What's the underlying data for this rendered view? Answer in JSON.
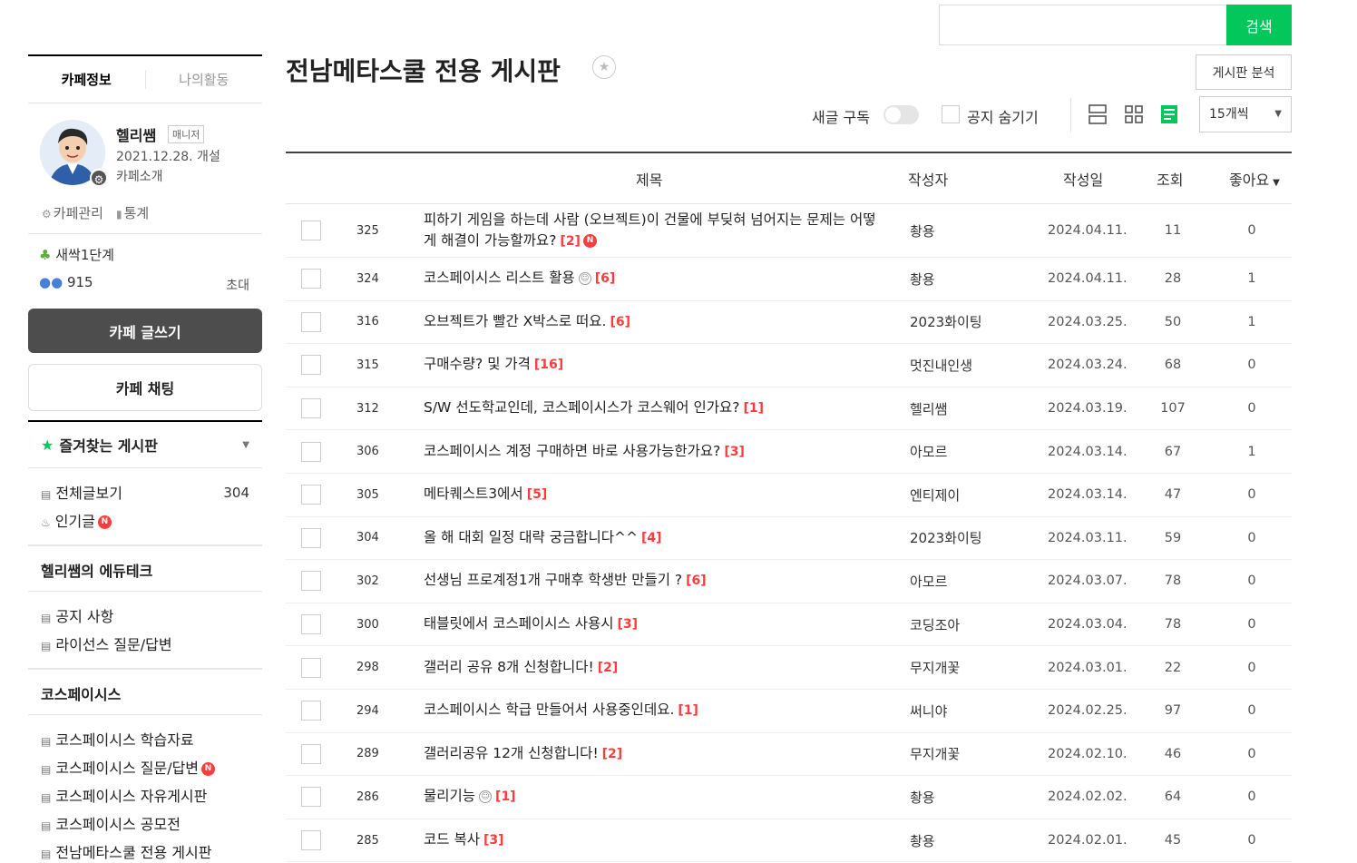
{
  "search": {
    "placeholder": "",
    "button_label": "검색"
  },
  "sidebar": {
    "tabs": [
      "카페정보",
      "나의활동"
    ],
    "manager": {
      "name": "헬리쌤",
      "badge": "매니저",
      "date": "2021.12.28. 개설",
      "intro": "카페소개"
    },
    "admin_links": [
      "카페관리",
      "통계"
    ],
    "level": "새싹1단계",
    "members": "915",
    "invite": "초대",
    "write_button": "카페 글쓰기",
    "chat_button": "카페 채팅",
    "favorites": "즐겨찾는 게시판",
    "group1": [
      {
        "label": "전체글보기",
        "count": "304"
      },
      {
        "label": "인기글"
      }
    ],
    "group2_title": "헬리쌤의 에듀테크",
    "group2": [
      "공지 사항",
      "라이선스 질문/답변"
    ],
    "group3_title": "코스페이시스",
    "group3": [
      "코스페이시스 학습자료",
      "코스페이시스 질문/답변",
      "코스페이시스 자유게시판",
      "코스페이시스 공모전",
      "전남메타스쿨 전용 게시판"
    ]
  },
  "board": {
    "title": "전남메타스쿨 전용 게시판",
    "analysis_button": "게시판 분석",
    "subscribe_label": "새글 구독",
    "hide_notice_label": "공지 숨기기",
    "per_page": "15개씩"
  },
  "table": {
    "headers": {
      "title": "제목",
      "author": "작성자",
      "date": "작성일",
      "views": "조회",
      "likes": "좋아요"
    },
    "rows": [
      {
        "num": "325",
        "title": "피하기 게임을 하는데 사람 (오브젝트)이 건물에 부딪혀 넘어지는 문제는 어떻게 해결이 가능할까요?",
        "comments": "[2]",
        "author": "촹용",
        "date": "2024.04.11.",
        "views": "11",
        "likes": "0"
      },
      {
        "num": "324",
        "title": "코스페이시스 리스트 활용",
        "comments": "[6]",
        "author": "촹용",
        "date": "2024.04.11.",
        "views": "28",
        "likes": "1"
      },
      {
        "num": "316",
        "title": "오브젝트가 빨간 X박스로 떠요.",
        "comments": "[6]",
        "author": "2023화이팅",
        "date": "2024.03.25.",
        "views": "50",
        "likes": "1"
      },
      {
        "num": "315",
        "title": "구매수량? 및 가격",
        "comments": "[16]",
        "author": "멋진내인생",
        "date": "2024.03.24.",
        "views": "68",
        "likes": "0"
      },
      {
        "num": "312",
        "title": "S/W 선도학교인데, 코스페이시스가 코스웨어 인가요?",
        "comments": "[1]",
        "author": "헬리쌤",
        "date": "2024.03.19.",
        "views": "107",
        "likes": "0"
      },
      {
        "num": "306",
        "title": "코스페이시스 계정 구매하면 바로 사용가능한가요?",
        "comments": "[3]",
        "author": "아모르",
        "date": "2024.03.14.",
        "views": "67",
        "likes": "1"
      },
      {
        "num": "305",
        "title": "메타퀘스트3에서",
        "comments": "[5]",
        "author": "엔티제이",
        "date": "2024.03.14.",
        "views": "47",
        "likes": "0"
      },
      {
        "num": "304",
        "title": "올 해 대회 일정 대략 궁금합니다^^",
        "comments": "[4]",
        "author": "2023화이팅",
        "date": "2024.03.11.",
        "views": "59",
        "likes": "0"
      },
      {
        "num": "302",
        "title": "선생님 프로계정1개 구매후 학생반 만들기 ?",
        "comments": "[6]",
        "author": "아모르",
        "date": "2024.03.07.",
        "views": "78",
        "likes": "0"
      },
      {
        "num": "300",
        "title": "태블릿에서 코스페이시스 사용시",
        "comments": "[3]",
        "author": "코딩조아",
        "date": "2024.03.04.",
        "views": "78",
        "likes": "0"
      },
      {
        "num": "298",
        "title": "갤러리 공유 8개 신청합니다!",
        "comments": "[2]",
        "author": "무지개꽃",
        "date": "2024.03.01.",
        "views": "22",
        "likes": "0"
      },
      {
        "num": "294",
        "title": "코스페이시스 학급 만들어서 사용중인데요.",
        "comments": "[1]",
        "author": "써니야",
        "date": "2024.02.25.",
        "views": "97",
        "likes": "0"
      },
      {
        "num": "289",
        "title": "갤러리공유 12개 신청합니다!",
        "comments": "[2]",
        "author": "무지개꽃",
        "date": "2024.02.10.",
        "views": "46",
        "likes": "0"
      },
      {
        "num": "286",
        "title": "물리기능",
        "comments": "[1]",
        "author": "촹용",
        "date": "2024.02.02.",
        "views": "64",
        "likes": "0"
      },
      {
        "num": "285",
        "title": "코드 복사",
        "comments": "[3]",
        "author": "촹용",
        "date": "2024.02.01.",
        "views": "45",
        "likes": "0"
      }
    ]
  },
  "colors": {
    "accent": "#03c75a",
    "new_badge": "#ff3b3b",
    "comment": "#ff3b3b"
  },
  "icons": [
    "search-icon",
    "star-icon",
    "gear-icon",
    "chart-icon",
    "sprout-icon",
    "people-icon",
    "doc-icon",
    "fire-icon",
    "new-icon",
    "list-view-icon",
    "card-view-icon",
    "album-view-icon",
    "emoji-icon"
  ]
}
